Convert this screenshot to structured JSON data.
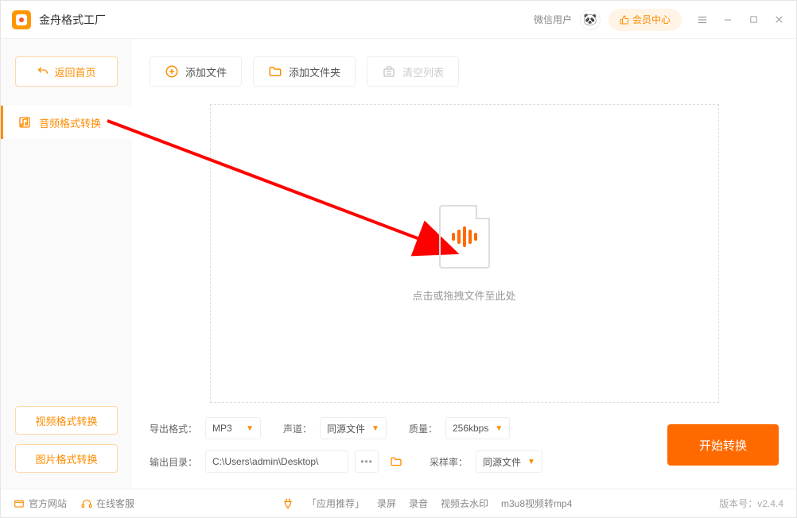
{
  "app": {
    "title": "金舟格式工厂"
  },
  "titlebar": {
    "user_label": "微信用户",
    "member_btn": "会员中心"
  },
  "sidebar": {
    "back": "返回首页",
    "active_item": "音频格式转换",
    "video_mode": "视频格式转换",
    "image_mode": "图片格式转换"
  },
  "toolbar": {
    "add_file": "添加文件",
    "add_folder": "添加文件夹",
    "clear_list": "清空列表"
  },
  "dropzone": {
    "hint": "点击或拖拽文件至此处"
  },
  "settings": {
    "format_label": "导出格式：",
    "format_value": "MP3",
    "channel_label": "声道：",
    "channel_value": "同源文件",
    "quality_label": "质量：",
    "quality_value": "256kbps",
    "outdir_label": "输出目录：",
    "outdir_value": "C:\\Users\\admin\\Desktop\\",
    "samplerate_label": "采样率：",
    "samplerate_value": "同源文件",
    "start": "开始转换"
  },
  "footer": {
    "site": "官方网站",
    "support": "在线客服",
    "recommend": "「应用推荐」",
    "rec1": "录屏",
    "rec2": "录音",
    "rec3": "视频去水印",
    "rec4": "m3u8视频转mp4",
    "version_label": "版本号：",
    "version": "v2.4.4"
  }
}
